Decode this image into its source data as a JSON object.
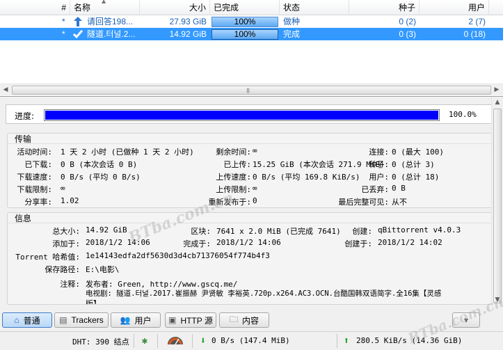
{
  "torrent_list": {
    "columns": {
      "num": "#",
      "name": "名称",
      "size": "大小",
      "done": "已完成",
      "status": "状态",
      "seeds": "种子",
      "peers": "用户"
    },
    "rows": [
      {
        "num": "*",
        "name": "请回答198...",
        "size": "27.93 GiB",
        "progress": "100%",
        "status": "做种",
        "seeds": "0 (2)",
        "peers": "2 (7)",
        "icon": "arrow-up-icon"
      },
      {
        "num": "*",
        "name": "隧道.터널.2...",
        "size": "14.92 GiB",
        "progress": "100%",
        "status": "完成",
        "seeds": "0 (3)",
        "peers": "0 (18)",
        "icon": "checkmark-icon"
      }
    ]
  },
  "progress": {
    "label": "进度:",
    "value": "100.0%",
    "fraction": 1.0
  },
  "transfer": {
    "title": "传输",
    "active_time_label": "活动时间:",
    "active_time_value": "1 天 2 小时 (已做种 1 天 2 小时)",
    "remaining_label": "剩余时间:",
    "remaining_value": "∞",
    "connections_label": "连接:",
    "connections_value": "0 (最大 100)",
    "downloaded_label": "已下载:",
    "downloaded_value": "0  B (本次会话 0  B)",
    "uploaded_label": "已上传:",
    "uploaded_value": "15.25  GiB (本次会话 271.9 MiB)",
    "seeds_label": "种子:",
    "seeds_value": "0 (总计 3)",
    "dl_speed_label": "下载速度:",
    "dl_speed_value": "0  B/s (平均 0  B/s)",
    "ul_speed_label": "上传速度:",
    "ul_speed_value": "0  B/s (平均 169.8  KiB/s)",
    "peers_label": "用户:",
    "peers_value": "0 (总计 18)",
    "dl_limit_label": "下载限制:",
    "dl_limit_value": "∞",
    "ul_limit_label": "上传限制:",
    "ul_limit_value": "∞",
    "wasted_label": "已丢弃:",
    "wasted_value": "0  B",
    "ratio_label": "分享率:",
    "ratio_value": "1.02",
    "reannounce_label": "重新发布于:",
    "reannounce_value": "0",
    "last_seen_label": "最后完整可见:",
    "last_seen_value": "从不"
  },
  "info": {
    "title": "信息",
    "total_size_label": "总大小:",
    "total_size_value": "14.92  GiB",
    "pieces_label": "区块:",
    "pieces_value": "7641 x 2.0  MiB (已完成 7641)",
    "created_by_label": "创建:",
    "created_by_value": "qBittorrent v4.0.3",
    "added_label": "添加于:",
    "added_value": "2018/1/2 14:06",
    "completed_label": "完成于:",
    "completed_value": "2018/1/2 14:06",
    "created_on_label": "创建于:",
    "created_on_value": "2018/1/2 14:02",
    "hash_label": "Torrent 哈希值:",
    "hash_value": "1e14143edfa2df5630d3d4cb71376054f774b4f3",
    "save_path_label": "保存路径:",
    "save_path_value": "E:\\电影\\",
    "comment_label": "注释:",
    "comment_line1": "发布者: Green, http://www.gscq.me/",
    "comment_line2": "电视剧: 隧道.터널.2017.崔振赫 尹贤敏 李裕英.720p.x264.AC3.OCN.台酷国韩双语简字.全16集【灵感",
    "comment_line3": "版】"
  },
  "tabs": [
    {
      "label": "普通",
      "icon": "home-icon"
    },
    {
      "label": "Trackers",
      "icon": "tracker-icon"
    },
    {
      "label": "用户",
      "icon": "users-icon"
    },
    {
      "label": "HTTP 源",
      "icon": "http-icon"
    },
    {
      "label": "内容",
      "icon": "folder-icon"
    }
  ],
  "statusbar": {
    "dht": "DHT: 390 结点",
    "download": "0  B/s (147.4  MiB)",
    "upload": "280.5  KiB/s (14.36  GiB)"
  },
  "watermark": {
    "text": "BTba.com.cn"
  },
  "colors": {
    "selection": "#3399ff",
    "progress_fill": "#0000ff",
    "active_tab": "#b9d8f6"
  }
}
